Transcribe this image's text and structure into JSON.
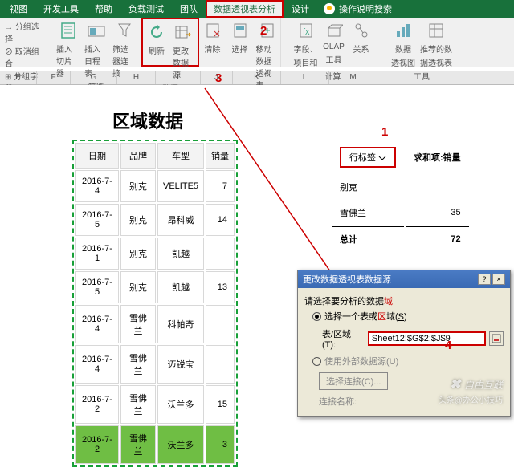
{
  "tabs": {
    "t1": "视图",
    "t2": "开发工具",
    "t3": "帮助",
    "t4": "负载测试",
    "t5": "团队",
    "t6": "数据透视表分析",
    "t7": "设计",
    "help": "操作说明搜索"
  },
  "ribbon": {
    "g1": {
      "l1": "分组选择",
      "l2": "取消组合",
      "l3": "分组字段",
      "lbl": "组合"
    },
    "g2": {
      "i1": "插入切片器",
      "i2": "插入日程表",
      "i3": "筛选器连接",
      "lbl": "筛选"
    },
    "g3": {
      "i1": "刷新",
      "i2": "更改数据源",
      "lbl": "数据"
    },
    "g4": {
      "i1": "清除",
      "i2": "选择",
      "i3": "移动数据透视表",
      "lbl": "操作"
    },
    "g5": {
      "i1": "字段、项目和集",
      "i2": "OLAP 工具",
      "i3": "关系",
      "lbl": "计算"
    },
    "g6": {
      "i1": "数据透视图",
      "i2": "推荐的数据透视表",
      "lbl": "工具"
    }
  },
  "cols": {
    "e": "E",
    "f": "F",
    "g": "G",
    "h": "H",
    "i": "I",
    "j": "J",
    "k": "K",
    "l": "L",
    "m": "M"
  },
  "title": "区域数据",
  "table": {
    "h": {
      "c1": "日期",
      "c2": "品牌",
      "c3": "车型",
      "c4": "销量"
    },
    "r": [
      {
        "c1": "2016-7-4",
        "c2": "别克",
        "c3": "VELITE5",
        "c4": "7"
      },
      {
        "c1": "2016-7-5",
        "c2": "别克",
        "c3": "昂科威",
        "c4": "14"
      },
      {
        "c1": "2016-7-1",
        "c2": "别克",
        "c3": "凯越",
        "c4": ""
      },
      {
        "c1": "2016-7-5",
        "c2": "别克",
        "c3": "凯越",
        "c4": "13"
      },
      {
        "c1": "2016-7-4",
        "c2": "雪佛兰",
        "c3": "科帕奇",
        "c4": ""
      },
      {
        "c1": "2016-7-4",
        "c2": "雪佛兰",
        "c3": "迈锐宝",
        "c4": ""
      },
      {
        "c1": "2016-7-2",
        "c2": "雪佛兰",
        "c3": "沃兰多",
        "c4": "15"
      },
      {
        "c1": "2016-7-2",
        "c2": "雪佛兰",
        "c3": "沃兰多",
        "c4": "3"
      }
    ]
  },
  "pivot": {
    "rowlab": "行标签",
    "sumlab": "求和项:销量",
    "r1": {
      "n": "别克",
      "v": ""
    },
    "r2": {
      "n": "雪佛兰",
      "v": "35"
    },
    "tot": {
      "n": "总计",
      "v": "72"
    }
  },
  "dialog": {
    "title": "更改数据透视表数据源",
    "line1": "请选择要分析的数据",
    "opt1": "选择一个表或区域(S)",
    "fld": "表/区域(T):",
    "val": "Sheet12!$G$2:$J$9",
    "opt2": "使用外部数据源(U)",
    "btn": "选择连接(C)...",
    "conn": "连接名称:"
  },
  "ann": {
    "a1": "1",
    "a2": "2",
    "a3": "3",
    "a4": "4"
  },
  "wm": {
    "l1": "自由互联",
    "l2": "头条@办公小技巧"
  }
}
